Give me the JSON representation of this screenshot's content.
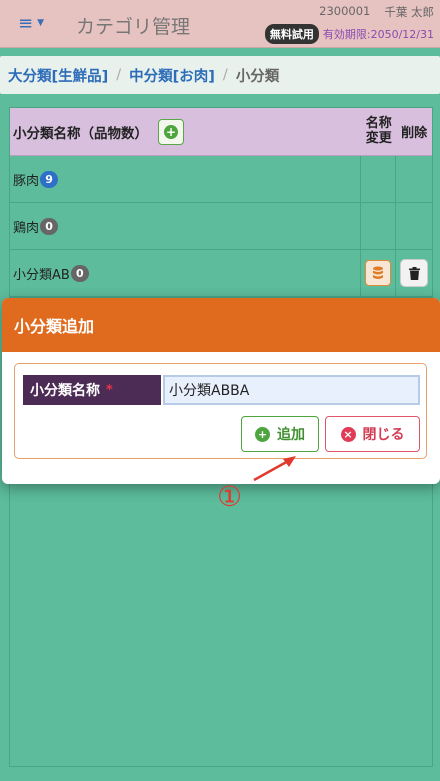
{
  "header": {
    "title": "カテゴリ管理",
    "user_id": "2300001",
    "user_name": "千葉 太郎",
    "trial_badge": "無料試用",
    "expiry": "有効期限:2050/12/31"
  },
  "breadcrumb": {
    "level1": "大分類[生鮮品]",
    "level2": "中分類[お肉]",
    "level3": "小分類"
  },
  "table": {
    "header_name": "小分類名称（品物数）",
    "header_rename": "名称変更",
    "header_delete": "削除",
    "rows": [
      {
        "name": "豚肉",
        "count": "9",
        "badge_color": "#2e6fc8"
      },
      {
        "name": "鶏肉",
        "count": "0",
        "badge_color": "#666666"
      },
      {
        "name": "小分類AB",
        "count": "0",
        "badge_color": "#666666"
      }
    ]
  },
  "modal": {
    "title": "小分類追加",
    "field_label": "小分類名称",
    "required_mark": "*",
    "field_value": "小分類ABBA",
    "add_button": "追加",
    "close_button": "閉じる"
  },
  "annotation": {
    "number": "①"
  },
  "colors": {
    "background": "#5cbc9c",
    "header": "#e6c3c1",
    "modal_header": "#e06a1e",
    "table_header": "#d7bfdd",
    "accent_link": "#2c6cb8"
  }
}
